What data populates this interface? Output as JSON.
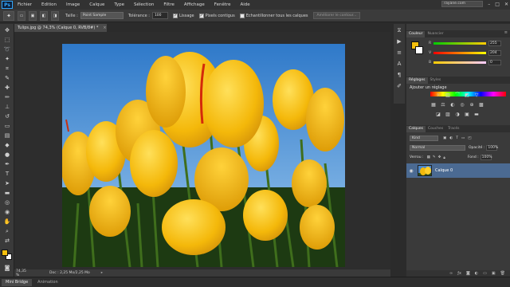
{
  "app": {
    "logo": "Ps"
  },
  "menu": [
    "Fichier",
    "Edition",
    "Image",
    "Calque",
    "Type",
    "Sélection",
    "Filtre",
    "Affichage",
    "Fenêtre",
    "Aide"
  ],
  "window": {
    "workspace_value": "rayane.com",
    "minimize": "–",
    "maximize": "□",
    "close": "✕"
  },
  "options": {
    "size_label": "Taille :",
    "sample_value": "Point Sample",
    "tolerance_label": "Tolérance :",
    "tolerance_value": "100",
    "antialias_label": "Lissage",
    "contiguous_label": "Pixels contigus",
    "all_layers_label": "Echantillonner tous les calques",
    "refine_button": "Améliorer le contour..."
  },
  "document": {
    "tab_title": "Tulips.jpg @ 74,3% (Calque 0, RVB/8#) *",
    "close": "×"
  },
  "status": {
    "zoom": "74,35 %",
    "doc_info": "Doc : 2,25 Mo/2,25 Mo",
    "arrow": "▸"
  },
  "bottom_tabs": {
    "mini_bridge": "Mini Bridge",
    "animation": "Animation"
  },
  "color_panel": {
    "tabs": [
      "Couleur",
      "Nuancier"
    ],
    "r_label": "R",
    "r_value": "255",
    "g_label": "V",
    "g_value": "204",
    "b_label": "B",
    "b_value": "0"
  },
  "adjust_panel": {
    "tabs": [
      "Réglages",
      "Styles"
    ],
    "title": "Ajouter un réglage"
  },
  "layers_panel": {
    "tabs": [
      "Calques",
      "Couches",
      "Tracés"
    ],
    "kind_value": "Kind",
    "blend_value": "Normal",
    "opacity_label": "Opacité :",
    "opacity_value": "100%",
    "lock_label": "Verrou :",
    "fill_label": "Fond :",
    "fill_value": "100%",
    "layer_name": "Calque 0"
  },
  "colors": {
    "foreground": "#f5c00d",
    "background": "#ffffff",
    "layer_selected": "#4b6a92"
  }
}
